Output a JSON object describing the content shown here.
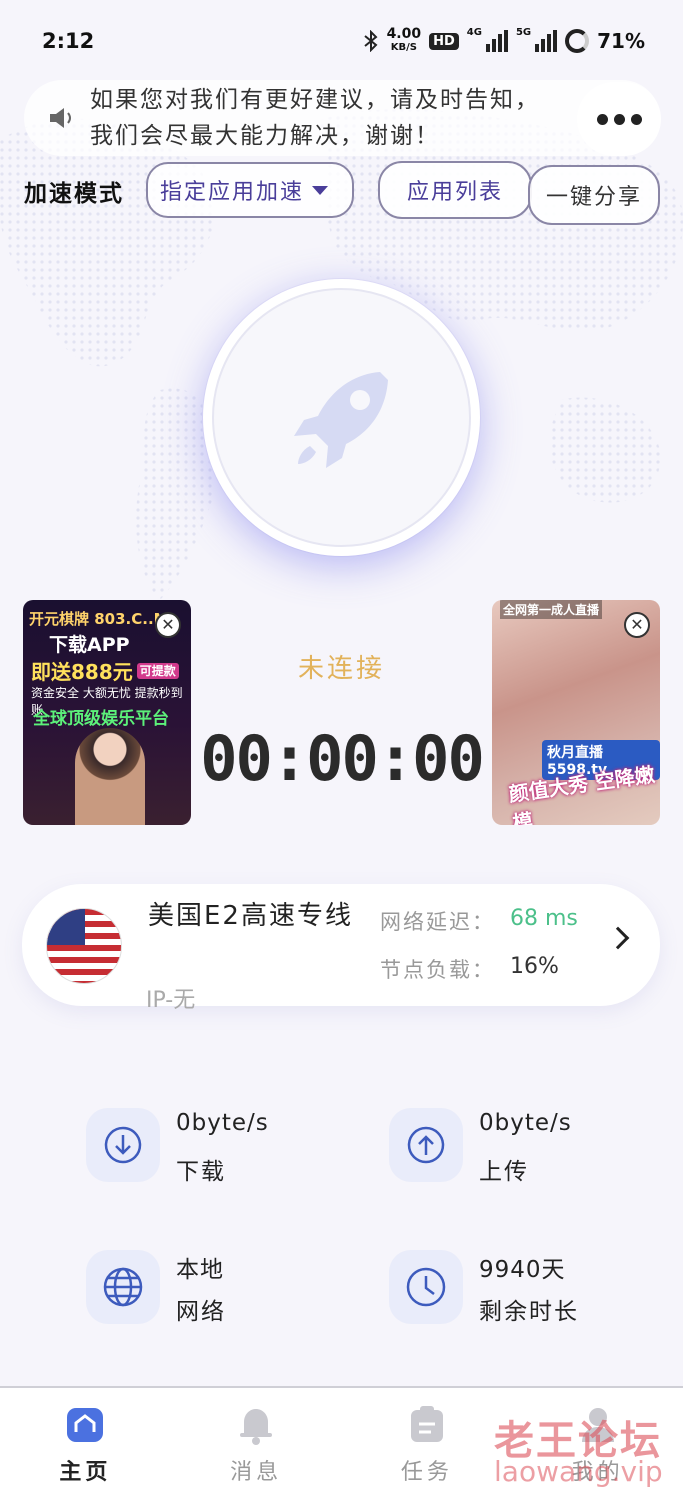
{
  "status_bar": {
    "time": "2:12",
    "net_speed": "4.00",
    "net_unit": "KB/S",
    "hd": "HD",
    "sig1": "4G",
    "sig2": "5G",
    "battery": "71%"
  },
  "notice": {
    "text": "如果您对我们有更好建议，请及时告知，我们会尽最大能力解决，谢谢！"
  },
  "mode": {
    "label": "加速模式",
    "selected": "指定应用加速"
  },
  "buttons": {
    "app_list": "应用列表",
    "share": "一键分享"
  },
  "ads": {
    "left": {
      "line1": "开元棋牌 803.C..M",
      "line2": "下载APP",
      "line3": "即送888元",
      "badge": "可提款",
      "line4": "资金安全 大额无忧 提款秒到账",
      "line5": "全球顶级娱乐平台"
    },
    "right": {
      "line1": "全网第一成人直播",
      "line2": "秋月直播 5598.tv",
      "line3": "颜值大秀 空降嫩模"
    }
  },
  "connection": {
    "status": "未连接",
    "timer": "00:00:00"
  },
  "server": {
    "name": "美国E2高速专线",
    "ip": "IP-无",
    "latency_label": "网络延迟：",
    "latency_value": "68 ms",
    "load_label": "节点负载：",
    "load_value": "16%",
    "latency_color": "#4cc08a"
  },
  "stats": {
    "download": {
      "value": "0byte/s",
      "label": "下载"
    },
    "upload": {
      "value": "0byte/s",
      "label": "上传"
    },
    "network": {
      "value": "本地",
      "label": "网络"
    },
    "remaining": {
      "value": "9940天",
      "label": "剩余时长"
    }
  },
  "tabs": [
    {
      "label": "主页",
      "icon": "home-icon",
      "active": true
    },
    {
      "label": "消息",
      "icon": "bell-icon",
      "active": false
    },
    {
      "label": "任务",
      "icon": "task-icon",
      "active": false
    },
    {
      "label": "我的",
      "icon": "profile-icon",
      "active": false
    }
  ],
  "watermark": {
    "line1": "老王论坛",
    "line2": "laowang.vip"
  },
  "colors": {
    "accent": "#4a3e9a",
    "status": "#e2b25a",
    "icon_blue": "#3d5bbd"
  }
}
